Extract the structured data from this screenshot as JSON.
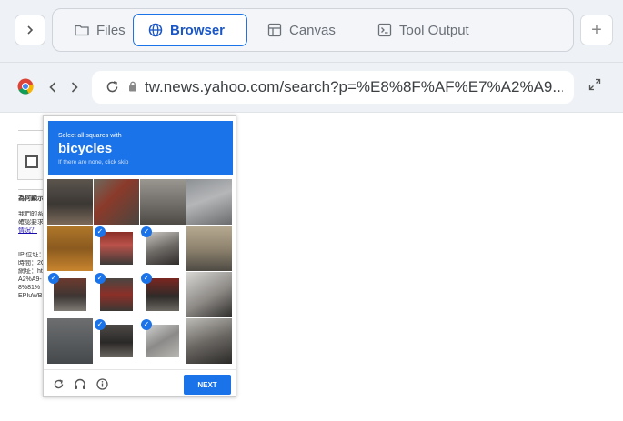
{
  "tabs": [
    {
      "label": "Files",
      "icon": "folder-icon"
    },
    {
      "label": "Browser",
      "icon": "globe-icon",
      "active": true
    },
    {
      "label": "Canvas",
      "icon": "layout-icon"
    },
    {
      "label": "Tool Output",
      "icon": "terminal-icon"
    }
  ],
  "topbar": {
    "expand_label": ">",
    "new_tab_label": "+"
  },
  "browser": {
    "url": "tw.news.yahoo.com/search?p=%E8%8F%AF%E7%A2%A9..."
  },
  "page": {
    "lines": [
      {
        "text": "為何顯示",
        "style": "bold"
      },
      {
        "text": "我們的系",
        "style": "normal"
      },
      {
        "text": "確認要求",
        "style": "normal"
      },
      {
        "text": "情況？",
        "style": "link"
      },
      {
        "text": "IP 位址：",
        "style": "normal"
      },
      {
        "text": "時間：2C",
        "style": "normal"
      },
      {
        "text": "網址：ht",
        "style": "normal"
      },
      {
        "text": "A2%A9-",
        "style": "normal"
      },
      {
        "text": "8%81%",
        "style": "normal"
      },
      {
        "text": "EPIuWB",
        "style": "normal"
      }
    ]
  },
  "captcha": {
    "instruction": "Select all squares with",
    "object": "bicycles",
    "subtext": "If there are none, click skip",
    "next_label": "NEXT",
    "accent": "#1a73e8",
    "tiles": [
      {
        "selected": false,
        "bg": "linear-gradient(180deg,#5b554e 0%,#3b3733 55%,#7b6a5b 100%)"
      },
      {
        "selected": false,
        "bg": "linear-gradient(135deg,#6b6a5e 0%,#8b3a2a 40%,#4a4640 100%)"
      },
      {
        "selected": false,
        "bg": "linear-gradient(180deg,#9a9690 0%,#6d6a66 60%,#4e4a46 100%)"
      },
      {
        "selected": false,
        "bg": "linear-gradient(160deg,#8e9194 0%,#b4b6b8 45%,#6a6c6e 100%)"
      },
      {
        "selected": false,
        "bg": "linear-gradient(180deg,#b0782a 0%,#8b5a1f 50%,#c8852e 100%)"
      },
      {
        "selected": true,
        "bg": "linear-gradient(180deg,#8a2f26 0%,#b9524a 40%,#3d3a38 100%)"
      },
      {
        "selected": true,
        "bg": "linear-gradient(160deg,#c9c6c1 0%,#6e6a66 50%,#2f2c2a 100%)"
      },
      {
        "selected": false,
        "bg": "linear-gradient(180deg,#b7aa92 0%,#8f846f 50%,#4e4a44 100%)"
      },
      {
        "selected": true,
        "bg": "linear-gradient(180deg,#6d3a2e 0%,#3d3633 55%,#7f7a74 100%)"
      },
      {
        "selected": true,
        "bg": "linear-gradient(180deg,#4a4643 0%,#8c2f27 50%,#3c3835 100%)"
      },
      {
        "selected": true,
        "bg": "linear-gradient(180deg,#7c2620 0%,#2e2b29 55%,#6b6761 100%)"
      },
      {
        "selected": false,
        "bg": "linear-gradient(150deg,#d7d6d3 0%,#8c8985 55%,#2f2d2b 100%)"
      },
      {
        "selected": false,
        "bg": "linear-gradient(180deg,#6c6e70 0%,#55585a 60%,#46494b 100%)"
      },
      {
        "selected": true,
        "bg": "linear-gradient(180deg,#4c4946 0%,#2b2928 55%,#6a6660 100%)"
      },
      {
        "selected": true,
        "bg": "linear-gradient(150deg,#cfd0d0 0%,#8b8a88 50%,#b8b7b3 100%)"
      },
      {
        "selected": false,
        "bg": "linear-gradient(160deg,#bdbbb6 0%,#6a6763 50%,#2c2a28 100%)"
      }
    ]
  }
}
